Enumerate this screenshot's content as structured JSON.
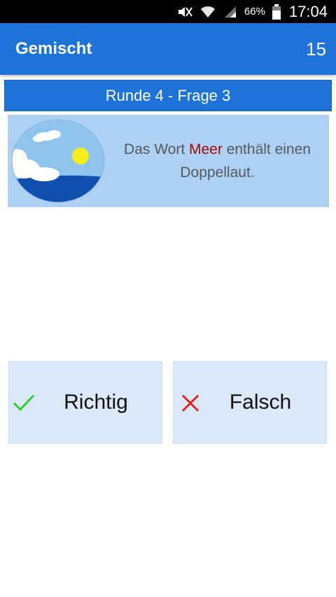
{
  "status_bar": {
    "icons": [
      "mute-icon",
      "wifi-icon",
      "signal-icon",
      "battery-icon"
    ],
    "battery": "66%",
    "time": "17:04"
  },
  "app_bar": {
    "title": "Gemischt",
    "score": "15"
  },
  "round": {
    "label": "Runde 4 - Frage 3"
  },
  "question": {
    "text_before": "Das Wort ",
    "highlight": "Meer",
    "text_after": " enthält einen Doppellaut.",
    "image_icon": "sea-sun-illustration"
  },
  "answers": {
    "correct_label": "Richtig",
    "wrong_label": "Falsch"
  },
  "colors": {
    "primary": "#1e73d8",
    "card": "#aed0f2",
    "button_bg": "#dbe8f8",
    "highlight": "#a00c0c",
    "check": "#2ecc2e",
    "cross": "#e81e1e"
  }
}
